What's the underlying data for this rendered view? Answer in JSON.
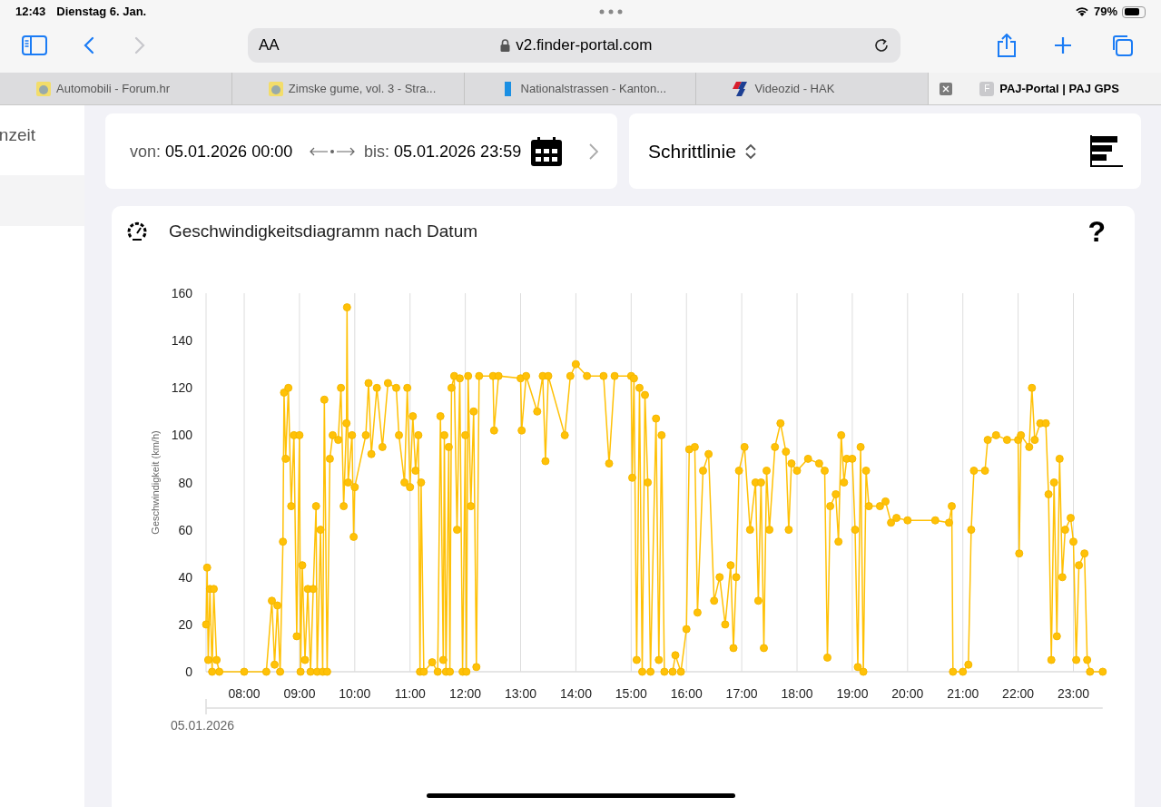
{
  "status_bar": {
    "time": "12:43",
    "date": "Dienstag 6. Jan.",
    "battery": "79%"
  },
  "toolbar": {
    "text_size": "AA",
    "address": "v2.finder-portal.com"
  },
  "tabs": [
    {
      "label": "Automobili - Forum.hr",
      "selected": false
    },
    {
      "label": "Zimske gume, vol. 3 - Stra...",
      "selected": false
    },
    {
      "label": "Nationalstrassen - Kanton...",
      "selected": false
    },
    {
      "label": "Videozid - HAK",
      "selected": false
    },
    {
      "label": "PAJ-Portal | PAJ GPS",
      "selected": true,
      "favicon_letter": "F"
    }
  ],
  "sidebar": {
    "items": [
      {
        "label": "nzeit"
      }
    ]
  },
  "date_range": {
    "from_label": "von:",
    "from_value": "05.01.2026 00:00",
    "to_label": "bis:",
    "to_value": "05.01.2026 23:59"
  },
  "chart_type": {
    "value": "Schrittlinie"
  },
  "speed_chart": {
    "title": "Geschwindigkeitsdiagramm nach Datum",
    "help": "?",
    "date_label": "05.01.2026",
    "chart_data": {
      "type": "line",
      "grid": true,
      "marker": true,
      "ylabel": "Geschwindigkeit (km/h)",
      "xlim": [
        7.31,
        23.53
      ],
      "ylim": [
        0,
        160
      ],
      "yticks": [
        0,
        20,
        40,
        60,
        80,
        100,
        120,
        140,
        160
      ],
      "xticks": [
        {
          "value": 8,
          "label": "08:00"
        },
        {
          "value": 9,
          "label": "09:00"
        },
        {
          "value": 10,
          "label": "10:00"
        },
        {
          "value": 11,
          "label": "11:00"
        },
        {
          "value": 12,
          "label": "12:00"
        },
        {
          "value": 13,
          "label": "13:00"
        },
        {
          "value": 14,
          "label": "14:00"
        },
        {
          "value": 15,
          "label": "15:00"
        },
        {
          "value": 16,
          "label": "16:00"
        },
        {
          "value": 17,
          "label": "17:00"
        },
        {
          "value": 18,
          "label": "18:00"
        },
        {
          "value": 19,
          "label": "19:00"
        },
        {
          "value": 20,
          "label": "20:00"
        },
        {
          "value": 21,
          "label": "21:00"
        },
        {
          "value": 22,
          "label": "22:00"
        },
        {
          "value": 23,
          "label": "23:00"
        }
      ],
      "x": [
        7.31,
        7.33,
        7.35,
        7.38,
        7.42,
        7.45,
        7.5,
        7.55,
        8.0,
        8.4,
        8.5,
        8.55,
        8.6,
        8.65,
        8.7,
        8.72,
        8.75,
        8.8,
        8.85,
        8.9,
        8.95,
        9.0,
        9.02,
        9.05,
        9.1,
        9.15,
        9.2,
        9.25,
        9.3,
        9.32,
        9.38,
        9.42,
        9.45,
        9.5,
        9.55,
        9.6,
        9.7,
        9.75,
        9.8,
        9.85,
        9.86,
        9.88,
        9.95,
        9.98,
        10.0,
        10.2,
        10.25,
        10.3,
        10.4,
        10.5,
        10.6,
        10.75,
        10.8,
        10.9,
        10.95,
        11.0,
        11.05,
        11.1,
        11.15,
        11.18,
        11.2,
        11.25,
        11.4,
        11.5,
        11.55,
        11.6,
        11.62,
        11.65,
        11.7,
        11.72,
        11.75,
        11.8,
        11.85,
        11.9,
        11.95,
        12.0,
        12.02,
        12.05,
        12.1,
        12.15,
        12.2,
        12.25,
        12.5,
        12.52,
        12.6,
        13.0,
        13.02,
        13.1,
        13.3,
        13.4,
        13.45,
        13.5,
        13.8,
        13.9,
        14.0,
        14.2,
        14.5,
        14.6,
        14.7,
        15.0,
        15.02,
        15.05,
        15.1,
        15.15,
        15.2,
        15.25,
        15.3,
        15.35,
        15.45,
        15.5,
        15.55,
        15.6,
        15.75,
        15.8,
        15.9,
        16.0,
        16.05,
        16.15,
        16.2,
        16.3,
        16.4,
        16.5,
        16.6,
        16.7,
        16.8,
        16.85,
        16.9,
        16.95,
        17.05,
        17.15,
        17.25,
        17.3,
        17.35,
        17.4,
        17.45,
        17.5,
        17.6,
        17.7,
        17.8,
        17.85,
        17.9,
        18.0,
        18.2,
        18.4,
        18.5,
        18.55,
        18.6,
        18.7,
        18.75,
        18.8,
        18.85,
        18.9,
        19.0,
        19.05,
        19.1,
        19.15,
        19.2,
        19.25,
        19.3,
        19.5,
        19.6,
        19.7,
        19.8,
        20.0,
        20.5,
        20.75,
        20.8,
        20.82,
        21.0,
        21.1,
        21.15,
        21.2,
        21.4,
        21.45,
        21.6,
        21.8,
        22.0,
        22.02,
        22.05,
        22.2,
        22.25,
        22.3,
        22.4,
        22.5,
        22.55,
        22.6,
        22.65,
        22.7,
        22.75,
        22.8,
        22.85,
        22.95,
        23.0,
        23.05,
        23.1,
        23.2,
        23.25,
        23.3,
        23.53
      ],
      "series": [
        {
          "color": "#ffc107",
          "values": [
            20,
            44,
            5,
            35,
            0,
            35,
            5,
            0,
            0,
            0,
            30,
            3,
            28,
            0,
            55,
            118,
            90,
            120,
            70,
            100,
            15,
            100,
            0,
            45,
            5,
            35,
            0,
            35,
            70,
            0,
            60,
            0,
            115,
            0,
            90,
            100,
            98,
            120,
            70,
            105,
            154,
            80,
            100,
            57,
            78,
            100,
            122,
            92,
            120,
            95,
            122,
            120,
            100,
            80,
            120,
            78,
            108,
            85,
            100,
            0,
            80,
            0,
            4,
            0,
            108,
            5,
            100,
            0,
            95,
            0,
            120,
            125,
            60,
            124,
            0,
            100,
            0,
            125,
            70,
            110,
            2,
            125,
            125,
            102,
            125,
            124,
            102,
            125,
            110,
            125,
            89,
            125,
            100,
            125,
            130,
            125,
            125,
            88,
            125,
            125,
            82,
            124,
            5,
            120,
            0,
            117,
            80,
            0,
            107,
            5,
            100,
            0,
            0,
            7,
            0,
            18,
            94,
            95,
            25,
            85,
            92,
            30,
            40,
            20,
            45,
            10,
            40,
            85,
            95,
            60,
            80,
            30,
            80,
            10,
            85,
            60,
            95,
            105,
            93,
            60,
            88,
            85,
            90,
            88,
            85,
            6,
            70,
            75,
            55,
            100,
            80,
            90,
            90,
            60,
            2,
            95,
            0,
            85,
            70,
            70,
            72,
            63,
            65,
            64,
            64,
            63,
            70,
            0,
            0,
            3,
            60,
            85,
            85,
            98,
            100,
            98,
            98,
            50,
            100,
            95,
            120,
            98,
            105,
            105,
            75,
            5,
            80,
            15,
            90,
            40,
            60,
            65,
            55,
            5,
            45,
            50,
            5,
            0,
            0
          ]
        }
      ]
    }
  }
}
